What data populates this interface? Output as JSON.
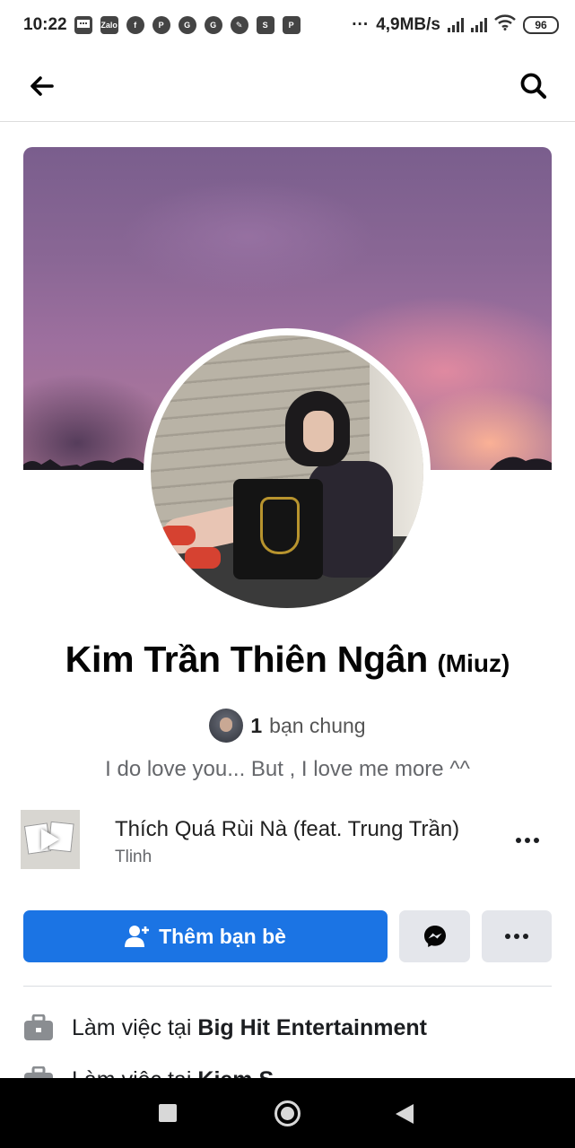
{
  "status_bar": {
    "time": "10:22",
    "notifications": [
      "message-icon",
      "zalo-icon",
      "facebook-icon",
      "pinterest-icon",
      "google-icon",
      "google-icon",
      "delivery-icon",
      "shopee-icon",
      "parking-icon"
    ],
    "zalo_label": "Zalo",
    "overflow": "···",
    "network_speed": "4,9MB/s",
    "battery": "96"
  },
  "top_nav": {
    "back_icon": "arrow-left-icon",
    "search_icon": "search-icon"
  },
  "profile": {
    "name": "Kim Trần Thiên Ngân",
    "alternate_name": "(Miuz)",
    "mutual_count": "1",
    "mutual_label": "bạn chung",
    "bio": "I do love you... But , I love me more ^^"
  },
  "music": {
    "title": "Thích Quá Rùi Nà (feat. Trung Trần)",
    "artist": "Tlinh"
  },
  "actions": {
    "add_friend_label": "Thêm bạn bè",
    "messenger_icon": "messenger-icon",
    "more_icon": "more-dots-icon"
  },
  "details": [
    {
      "prefix": "Làm việc tại",
      "value": "Big Hit Entertainment",
      "icon": "briefcase-icon"
    },
    {
      "prefix": "Làm việc tại",
      "value": "Kiem S",
      "icon": "briefcase-icon"
    }
  ],
  "colors": {
    "primary_button": "#1b74e4",
    "secondary_button": "#e4e6eb",
    "muted_text": "#65676b"
  }
}
